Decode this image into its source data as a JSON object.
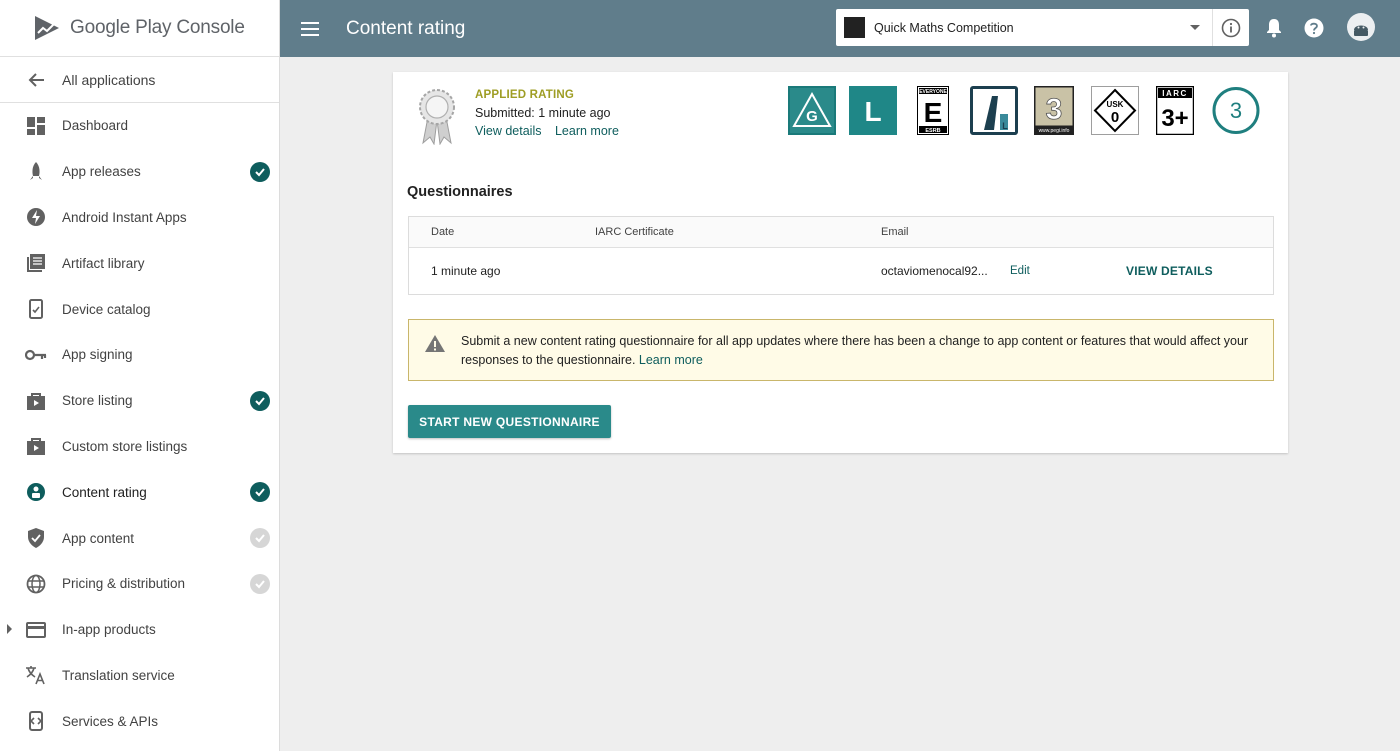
{
  "brand": {
    "name": "Google Play Console"
  },
  "sidebar": {
    "back_label": "All applications",
    "items": [
      {
        "label": "Dashboard",
        "icon": "dashboard-icon",
        "status": "none"
      },
      {
        "label": "App releases",
        "icon": "rocket-icon",
        "status": "done"
      },
      {
        "label": "Android Instant Apps",
        "icon": "bolt-icon",
        "status": "none"
      },
      {
        "label": "Artifact library",
        "icon": "library-icon",
        "status": "none"
      },
      {
        "label": "Device catalog",
        "icon": "device-icon",
        "status": "none"
      },
      {
        "label": "App signing",
        "icon": "key-icon",
        "status": "none"
      },
      {
        "label": "Store listing",
        "icon": "store-icon",
        "status": "done"
      },
      {
        "label": "Custom store listings",
        "icon": "store-icon",
        "status": "none"
      },
      {
        "label": "Content rating",
        "icon": "content-rating-icon",
        "status": "done",
        "active": true
      },
      {
        "label": "App content",
        "icon": "shield-icon",
        "status": "pending"
      },
      {
        "label": "Pricing & distribution",
        "icon": "globe-icon",
        "status": "pending"
      },
      {
        "label": "In-app products",
        "icon": "card-icon",
        "status": "none",
        "expandable": true
      },
      {
        "label": "Translation service",
        "icon": "translate-icon",
        "status": "none"
      },
      {
        "label": "Services & APIs",
        "icon": "api-icon",
        "status": "none"
      }
    ]
  },
  "header": {
    "title": "Content rating",
    "app_name": "Quick Maths Competition"
  },
  "rating": {
    "applied_label": "APPLIED RATING",
    "submitted": "Submitted: 1 minute ago",
    "view_details": "View details",
    "learn_more": "Learn more",
    "badges": {
      "g": "G",
      "l": "L",
      "esrb_top": "EVERYONE",
      "esrb_letter": "E",
      "esrb_bottom": "ESRB",
      "pegi_num": "3",
      "pegi_site": "www.pegi.info",
      "usk_top": "USK",
      "usk_num": "0",
      "iarc_top": "IARC",
      "iarc_num": "3+",
      "circle_num": "3"
    }
  },
  "questionnaires": {
    "title": "Questionnaires",
    "columns": [
      "Date",
      "IARC Certificate",
      "Email"
    ],
    "row": {
      "date": "1 minute ago",
      "certificate": "",
      "email": "octaviomenocal92...",
      "edit": "Edit",
      "view": "VIEW DETAILS"
    }
  },
  "notice": {
    "text": "Submit a new content rating questionnaire for all app updates where there has been a change to app content or features that would affect your responses to the questionnaire.",
    "link": "Learn more"
  },
  "start_button": "START NEW QUESTIONNAIRE",
  "colors": {
    "topbar": "#607d8b",
    "accent": "#0e5d5d",
    "button": "#2a8a8a",
    "applied": "#9e9d24"
  }
}
